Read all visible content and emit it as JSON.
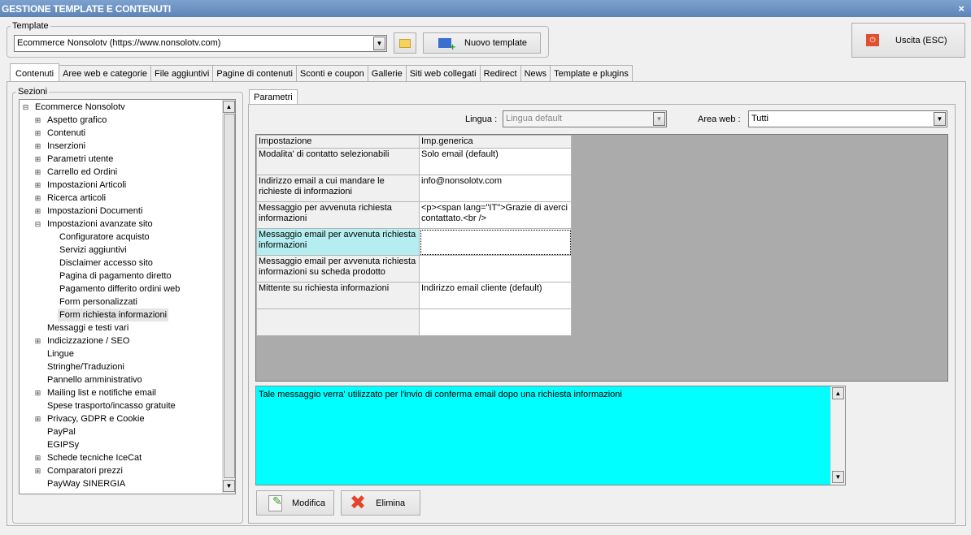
{
  "window": {
    "title": "GESTIONE TEMPLATE E CONTENUTI",
    "close": "×"
  },
  "template": {
    "legend": "Template",
    "selected": "Ecommerce Nonsolotv (https://www.nonsolotv.com)",
    "new_label": "Nuovo template"
  },
  "exit_label": "Uscita (ESC)",
  "tabs": [
    "Contenuti",
    "Aree web e categorie",
    "File aggiuntivi",
    "Pagine di contenuti",
    "Sconti e coupon",
    "Gallerie",
    "Siti web collegati",
    "Redirect",
    "News",
    "Template e plugins"
  ],
  "sections": {
    "legend": "Sezioni",
    "items": [
      {
        "label": "Ecommerce Nonsolotv",
        "level": 0,
        "expander": "-"
      },
      {
        "label": "Aspetto grafico",
        "level": 1,
        "expander": "+"
      },
      {
        "label": "Contenuti",
        "level": 1,
        "expander": "+"
      },
      {
        "label": "Inserzioni",
        "level": 1,
        "expander": "+"
      },
      {
        "label": "Parametri utente",
        "level": 1,
        "expander": "+"
      },
      {
        "label": "Carrello ed Ordini",
        "level": 1,
        "expander": "+"
      },
      {
        "label": "Impostazioni Articoli",
        "level": 1,
        "expander": "+"
      },
      {
        "label": "Ricerca articoli",
        "level": 1,
        "expander": "+"
      },
      {
        "label": "Impostazioni Documenti",
        "level": 1,
        "expander": "+"
      },
      {
        "label": "Impostazioni avanzate sito",
        "level": 1,
        "expander": "-"
      },
      {
        "label": "Configuratore acquisto",
        "level": 2
      },
      {
        "label": "Servizi aggiuntivi",
        "level": 2
      },
      {
        "label": "Disclaimer accesso sito",
        "level": 2
      },
      {
        "label": "Pagina di pagamento diretto",
        "level": 2
      },
      {
        "label": "Pagamento differito ordini web",
        "level": 2
      },
      {
        "label": "Form personalizzati",
        "level": 2
      },
      {
        "label": "Form richiesta informazioni",
        "level": 2,
        "selected": true
      },
      {
        "label": "Messaggi e testi vari",
        "level": 1
      },
      {
        "label": "Indicizzazione / SEO",
        "level": 1,
        "expander": "+"
      },
      {
        "label": "Lingue",
        "level": 1
      },
      {
        "label": "Stringhe/Traduzioni",
        "level": 1
      },
      {
        "label": "Pannello amministrativo",
        "level": 1
      },
      {
        "label": "Mailing list e notifiche email",
        "level": 1,
        "expander": "+"
      },
      {
        "label": "Spese trasporto/incasso gratuite",
        "level": 1
      },
      {
        "label": "Privacy, GDPR e Cookie",
        "level": 1,
        "expander": "+"
      },
      {
        "label": "PayPal",
        "level": 1
      },
      {
        "label": "EGIPSy",
        "level": 1
      },
      {
        "label": "Schede tecniche IceCat",
        "level": 1,
        "expander": "+"
      },
      {
        "label": "Comparatori prezzi",
        "level": 1,
        "expander": "+"
      },
      {
        "label": "PayWay SINERGIA",
        "level": 1
      }
    ]
  },
  "params": {
    "tab": "Parametri",
    "lingua_label": "Lingua :",
    "lingua_value": "Lingua default",
    "area_label": "Area web :",
    "area_value": "Tutti",
    "columns": [
      "Impostazione",
      "Imp.generica"
    ],
    "rows": [
      [
        "Modalita' di contatto selezionabili",
        "Solo email (default)"
      ],
      [
        "Indirizzo email a cui mandare le richieste di informazioni",
        "info@nonsolotv.com"
      ],
      [
        "Messaggio per avvenuta richiesta informazioni",
        "<p><span lang=\"IT\">Grazie di averci contattato.<br />"
      ],
      [
        "Messaggio email per avvenuta richiesta informazioni",
        ""
      ],
      [
        "Messaggio email per avvenuta richiesta informazioni su scheda prodotto",
        ""
      ],
      [
        "Mittente su richiesta informazioni",
        "Indirizzo email cliente (default)"
      ],
      [
        "",
        ""
      ]
    ],
    "selected_row": 3,
    "description": "Tale messaggio verra' utilizzato per l'invio di conferma email dopo una richiesta informazioni",
    "modify_label": "Modifica",
    "delete_label": "Elimina"
  },
  "colors": {
    "titlebar": "#6b90c2",
    "description_bg": "#00ffff",
    "selected_cell": "#b4eef0",
    "grid_bg": "#ababab"
  }
}
